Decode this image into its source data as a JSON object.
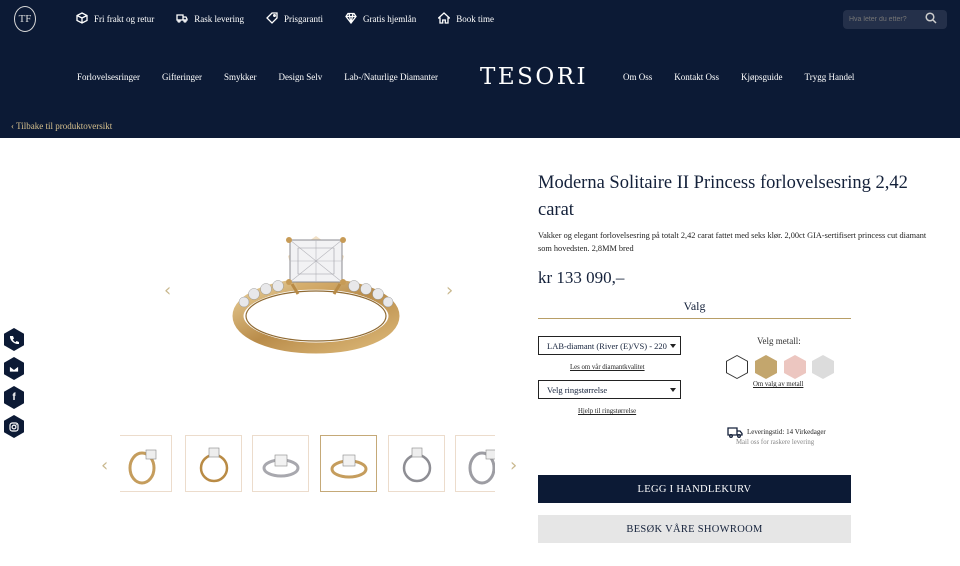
{
  "header": {
    "logo_monogram": "TF",
    "perks": [
      {
        "icon": "box-icon",
        "label": "Fri frakt og retur"
      },
      {
        "icon": "truck-icon",
        "label": "Rask levering"
      },
      {
        "icon": "tag-icon",
        "label": "Prisgaranti"
      },
      {
        "icon": "diamond-icon",
        "label": "Gratis hjemlån"
      },
      {
        "icon": "home-icon",
        "label": "Book time"
      }
    ],
    "search_placeholder": "Hva leter du etter?",
    "nav_left": [
      "Forlovelsesringer",
      "Gifteringer",
      "Smykker",
      "Design Selv",
      "Lab-/Naturlige Diamanter"
    ],
    "brand": "TESORI",
    "nav_right": [
      "Om Oss",
      "Kontakt Oss",
      "Kjøpsguide",
      "Trygg Handel"
    ],
    "back_link": "Tilbake til produktoversikt"
  },
  "side_icons": [
    "phone-icon",
    "mail-icon",
    "facebook-icon",
    "instagram-icon"
  ],
  "product": {
    "title": "Moderna Solitaire II Princess forlovelsesring 2,42 carat",
    "description": "Vakker og elegant forlovelsesring på totalt 2,42 carat fattet med seks klør. 2,00ct GIA-sertifisert princess cut diamant som hovedsten. 2,8MM bred",
    "price": "kr 133 090,–",
    "options_heading": "Valg",
    "diamond_select": "LAB-diamant (River (E)/VS) - 220",
    "diamond_info_link": "Les om vår diamantkvalitet",
    "size_select": "Velg ringstørrelse",
    "size_help_link": "Hjelp til ringstørrelse",
    "metal_label": "Velg metall:",
    "metal_colors": [
      "#ffffff",
      "#c3a66d",
      "#ecc6c0",
      "#dcdcdc"
    ],
    "metal_link": "Om valg av metall",
    "delivery_time": "Leveringstid: 14 Virkedager",
    "delivery_note": "Mail oss for raskere levering",
    "add_to_cart": "LEGG I HANDLEKURV",
    "showroom": "BESØK VÅRE SHOWROOM"
  },
  "gallery": {
    "thumbnails": [
      "ring-yellow-gold-angled",
      "ring-yellow-gold-front",
      "ring-white-gold-top",
      "ring-yellow-gold-top",
      "ring-white-gold-front",
      "ring-white-gold-angled"
    ],
    "selected_index": 3
  }
}
